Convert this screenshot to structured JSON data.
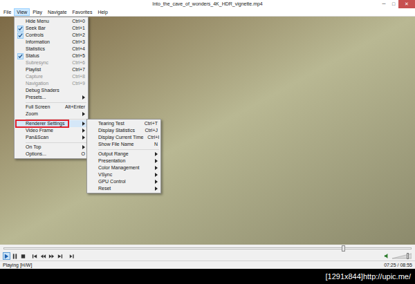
{
  "window": {
    "title": "Into_the_cave_of_wonders_4K_HDR_vignette.mp4",
    "controls": [
      "─",
      "□",
      "✕"
    ]
  },
  "menubar": [
    {
      "label": "File",
      "selected": false
    },
    {
      "label": "View",
      "selected": true
    },
    {
      "label": "Play",
      "selected": false
    },
    {
      "label": "Navigate",
      "selected": false
    },
    {
      "label": "Favorites",
      "selected": false
    },
    {
      "label": "Help",
      "selected": false
    }
  ],
  "view_menu": {
    "items": [
      {
        "kind": "item",
        "label": "Hide Menu",
        "shortcut": "Ctrl+0",
        "checked": false,
        "disabled": false,
        "submenu": false,
        "highlighted": false,
        "annotated": false
      },
      {
        "kind": "item",
        "label": "Seek Bar",
        "shortcut": "Ctrl+1",
        "checked": true,
        "disabled": false,
        "submenu": false,
        "highlighted": false,
        "annotated": false
      },
      {
        "kind": "item",
        "label": "Controls",
        "shortcut": "Ctrl+2",
        "checked": true,
        "disabled": false,
        "submenu": false,
        "highlighted": false,
        "annotated": false
      },
      {
        "kind": "item",
        "label": "Information",
        "shortcut": "Ctrl+3",
        "checked": false,
        "disabled": false,
        "submenu": false,
        "highlighted": false,
        "annotated": false
      },
      {
        "kind": "item",
        "label": "Statistics",
        "shortcut": "Ctrl+4",
        "checked": false,
        "disabled": false,
        "submenu": false,
        "highlighted": false,
        "annotated": false
      },
      {
        "kind": "item",
        "label": "Status",
        "shortcut": "Ctrl+5",
        "checked": true,
        "disabled": false,
        "submenu": false,
        "highlighted": false,
        "annotated": false
      },
      {
        "kind": "item",
        "label": "Subresync",
        "shortcut": "Ctrl+6",
        "checked": false,
        "disabled": true,
        "submenu": false,
        "highlighted": false,
        "annotated": false
      },
      {
        "kind": "item",
        "label": "Playlist",
        "shortcut": "Ctrl+7",
        "checked": false,
        "disabled": false,
        "submenu": false,
        "highlighted": false,
        "annotated": false
      },
      {
        "kind": "item",
        "label": "Capture",
        "shortcut": "Ctrl+8",
        "checked": false,
        "disabled": true,
        "submenu": false,
        "highlighted": false,
        "annotated": false
      },
      {
        "kind": "item",
        "label": "Navigation",
        "shortcut": "Ctrl+9",
        "checked": false,
        "disabled": true,
        "submenu": false,
        "highlighted": false,
        "annotated": false
      },
      {
        "kind": "item",
        "label": "Debug Shaders",
        "shortcut": "",
        "checked": false,
        "disabled": false,
        "submenu": false,
        "highlighted": false,
        "annotated": false
      },
      {
        "kind": "item",
        "label": "Presets...",
        "shortcut": "",
        "checked": false,
        "disabled": false,
        "submenu": true,
        "highlighted": false,
        "annotated": false
      },
      {
        "kind": "separator"
      },
      {
        "kind": "item",
        "label": "Full Screen",
        "shortcut": "Alt+Enter",
        "checked": false,
        "disabled": false,
        "submenu": false,
        "highlighted": false,
        "annotated": false
      },
      {
        "kind": "item",
        "label": "Zoom",
        "shortcut": "",
        "checked": false,
        "disabled": false,
        "submenu": true,
        "highlighted": false,
        "annotated": false
      },
      {
        "kind": "separator"
      },
      {
        "kind": "item",
        "label": "Renderer Settings",
        "shortcut": "",
        "checked": false,
        "disabled": false,
        "submenu": true,
        "highlighted": true,
        "annotated": true
      },
      {
        "kind": "item",
        "label": "Video Frame",
        "shortcut": "",
        "checked": false,
        "disabled": false,
        "submenu": true,
        "highlighted": false,
        "annotated": false
      },
      {
        "kind": "item",
        "label": "Pan&Scan",
        "shortcut": "",
        "checked": false,
        "disabled": false,
        "submenu": true,
        "highlighted": false,
        "annotated": false
      },
      {
        "kind": "separator"
      },
      {
        "kind": "item",
        "label": "On Top",
        "shortcut": "",
        "checked": false,
        "disabled": false,
        "submenu": true,
        "highlighted": false,
        "annotated": false
      },
      {
        "kind": "item",
        "label": "Options...",
        "shortcut": "O",
        "checked": false,
        "disabled": false,
        "submenu": false,
        "highlighted": false,
        "annotated": false
      }
    ]
  },
  "renderer_submenu": {
    "items": [
      {
        "kind": "item",
        "label": "Tearing Test",
        "shortcut": "Ctrl+T",
        "submenu": false
      },
      {
        "kind": "item",
        "label": "Display Statistics",
        "shortcut": "Ctrl+J",
        "submenu": false
      },
      {
        "kind": "item",
        "label": "Display Current Time",
        "shortcut": "Ctrl+I",
        "submenu": false
      },
      {
        "kind": "item",
        "label": "Show File Name",
        "shortcut": "N",
        "submenu": false
      },
      {
        "kind": "separator"
      },
      {
        "kind": "item",
        "label": "Output Range",
        "shortcut": "",
        "submenu": true
      },
      {
        "kind": "item",
        "label": "Presentation",
        "shortcut": "",
        "submenu": true
      },
      {
        "kind": "item",
        "label": "Color Management",
        "shortcut": "",
        "submenu": true
      },
      {
        "kind": "item",
        "label": "VSync",
        "shortcut": "",
        "submenu": true
      },
      {
        "kind": "item",
        "label": "GPU Control",
        "shortcut": "",
        "submenu": true
      },
      {
        "kind": "item",
        "label": "Reset",
        "shortcut": "",
        "submenu": true
      }
    ]
  },
  "seekbar": {
    "level": 0.83
  },
  "player_buttons": [
    {
      "kind": "play",
      "pressed": true
    },
    {
      "kind": "pause",
      "pressed": false
    },
    {
      "kind": "stop",
      "pressed": false
    },
    {
      "kind": "prev",
      "pressed": false
    },
    {
      "kind": "rewind",
      "pressed": false
    },
    {
      "kind": "forward",
      "pressed": false
    },
    {
      "kind": "next",
      "pressed": false
    },
    {
      "kind": "step",
      "pressed": false
    }
  ],
  "volume": {
    "level": 0.85
  },
  "status_bar": {
    "state": "Playing [H/W]",
    "time": "07:25 / 08:55"
  },
  "watermark": "[1291x844]http://upic.me/"
}
